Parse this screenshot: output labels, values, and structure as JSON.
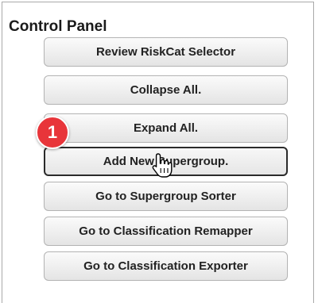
{
  "panel": {
    "title": "Control Panel",
    "buttons": [
      {
        "label": "Review RiskCat Selector"
      },
      {
        "label": "Collapse All."
      },
      {
        "label": "Expand All."
      },
      {
        "label": "Add New Supergroup."
      },
      {
        "label": "Go to Supergroup Sorter"
      },
      {
        "label": "Go to Classification Remapper"
      },
      {
        "label": "Go to Classification Exporter"
      }
    ]
  },
  "annotation": {
    "step_number": "1",
    "badge_color": "#e8353a"
  },
  "pointer": {
    "icon": "hand-pointer-icon"
  }
}
